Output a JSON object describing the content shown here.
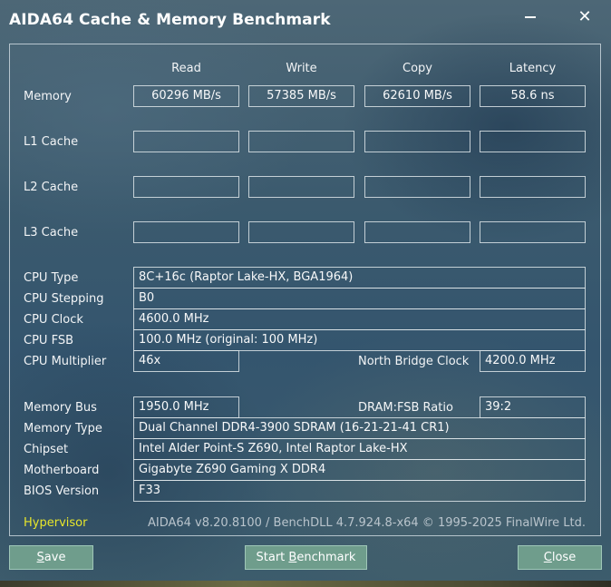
{
  "window": {
    "title": "AIDA64 Cache & Memory Benchmark"
  },
  "columns": [
    "Read",
    "Write",
    "Copy",
    "Latency"
  ],
  "rows": [
    {
      "label": "Memory",
      "values": [
        "60296 MB/s",
        "57385 MB/s",
        "62610 MB/s",
        "58.6 ns"
      ]
    },
    {
      "label": "L1 Cache",
      "values": [
        "",
        "",
        "",
        ""
      ]
    },
    {
      "label": "L2 Cache",
      "values": [
        "",
        "",
        "",
        ""
      ]
    },
    {
      "label": "L3 Cache",
      "values": [
        "",
        "",
        "",
        ""
      ]
    }
  ],
  "cpu": {
    "type_label": "CPU Type",
    "type_value": "8C+16c   (Raptor Lake-HX, BGA1964)",
    "stepping_label": "CPU Stepping",
    "stepping_value": "B0",
    "clock_label": "CPU Clock",
    "clock_value": "4600.0 MHz",
    "fsb_label": "CPU FSB",
    "fsb_value": "100.0 MHz  (original: 100 MHz)",
    "multiplier_label": "CPU Multiplier",
    "multiplier_value": "46x",
    "nb_clock_label": "North Bridge Clock",
    "nb_clock_value": "4200.0 MHz"
  },
  "memory": {
    "bus_label": "Memory Bus",
    "bus_value": "1950.0 MHz",
    "ratio_label": "DRAM:FSB Ratio",
    "ratio_value": "39:2",
    "type_label": "Memory Type",
    "type_value": "Dual Channel DDR4-3900 SDRAM  (16-21-21-41 CR1)",
    "chipset_label": "Chipset",
    "chipset_value": "Intel Alder Point-S Z690, Intel Raptor Lake-HX",
    "motherboard_label": "Motherboard",
    "motherboard_value": "Gigabyte Z690 Gaming X DDR4",
    "bios_label": "BIOS Version",
    "bios_value": "F33"
  },
  "footer": {
    "hypervisor": "Hypervisor",
    "version": "AIDA64 v8.20.8100 / BenchDLL 4.7.924.8-x64  © 1995-2025 FinalWire Ltd."
  },
  "buttons": {
    "save_hotkey": "S",
    "save_rest": "ave",
    "start_prefix": "Start ",
    "start_hotkey": "B",
    "start_rest": "enchmark",
    "close_hotkey": "C",
    "close_rest": "lose"
  },
  "colors": {
    "hypervisor": "#e7e62b",
    "button": "#6f9d8c"
  }
}
